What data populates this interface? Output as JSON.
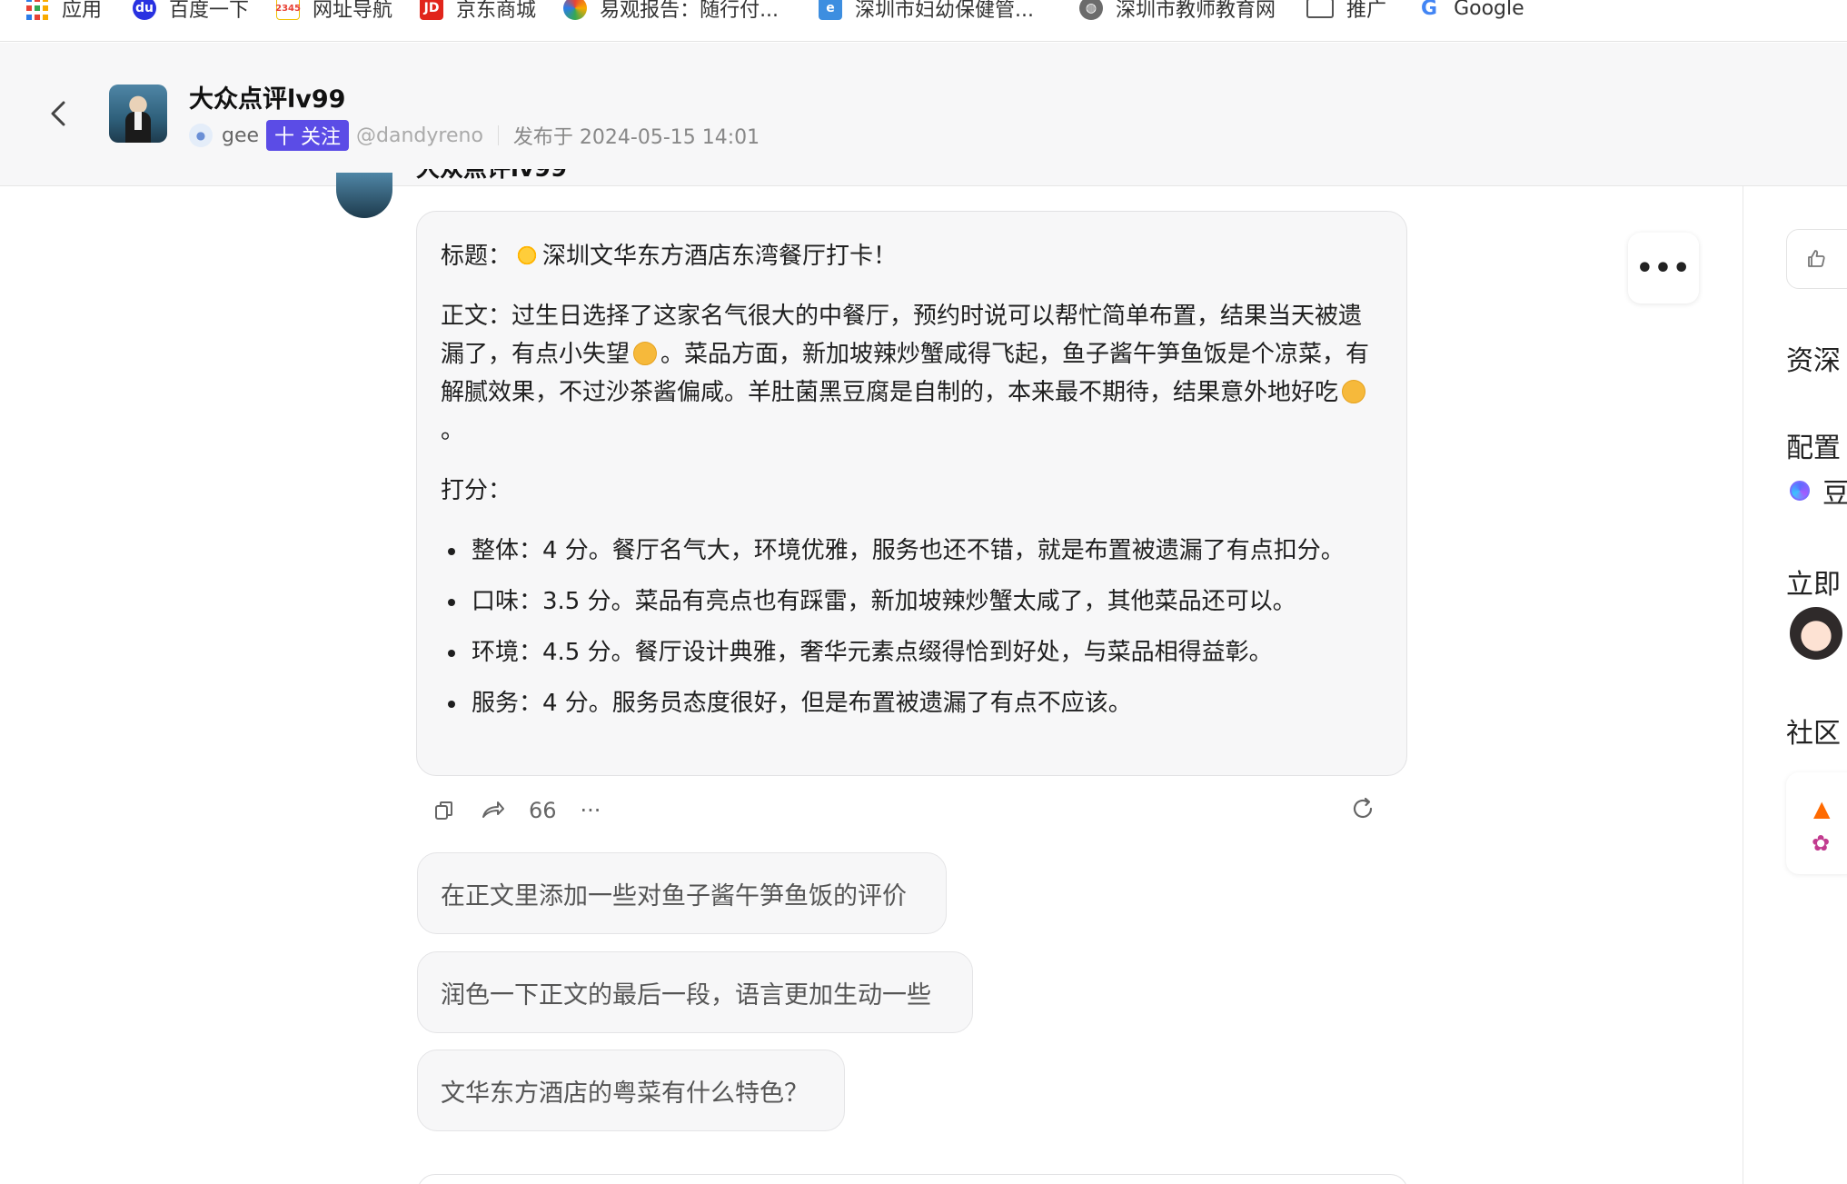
{
  "bookmarks": [
    {
      "label": "应用",
      "icon": "apps-grid-icon"
    },
    {
      "label": "百度一下",
      "icon": "baidu-paw-icon"
    },
    {
      "label": "网址导航",
      "icon": "hao2345-icon"
    },
    {
      "label": "京东商城",
      "icon": "jd-logo-icon"
    },
    {
      "label": "易观报告：随行付...",
      "icon": "analysys-icon"
    },
    {
      "label": "深圳市妇幼保健管...",
      "icon": "hospital-site-icon"
    },
    {
      "label": "深圳市教师教育网",
      "icon": "globe-icon"
    },
    {
      "label": "推广",
      "icon": "folder-icon"
    },
    {
      "label": "Google",
      "icon": "google-g-icon"
    }
  ],
  "header": {
    "title": "大众点评lv99",
    "user_name": "gee",
    "follow_label": "十 关注",
    "handle": "@dandyreno",
    "published": "发布于 2024-05-15 14:01"
  },
  "message": {
    "sender_name": "大众点评lv99",
    "title_prefix": "标题：",
    "title_text": "深圳文华东方酒店东湾餐厅打卡！",
    "body_part1": "正文：过生日选择了这家名气很大的中餐厅，预约时说可以帮忙简单布置，结果当天被遗漏了，有点小失望",
    "body_part2": "。菜品方面，新加坡辣炒蟹咸得飞起，鱼子酱午笋鱼饭是个凉菜，有解腻效果，不过沙茶酱偏咸。羊肚菌黑豆腐是自制的，本来最不期待，结果意外地好吃",
    "body_part3": "。",
    "score_heading": "打分：",
    "scores": [
      "整体：4 分。餐厅名气大，环境优雅，服务也还不错，就是布置被遗漏了有点扣分。",
      "口味：3.5 分。菜品有亮点也有踩雷，新加坡辣炒蟹太咸了，其他菜品还可以。",
      "环境：4.5 分。餐厅设计典雅，奢华元素点缀得恰到好处，与菜品相得益彰。",
      "服务：4 分。服务员态度很好，但是布置被遗漏了有点不应该。"
    ],
    "emojis": [
      "sun-emoji-icon",
      "disappointed-face-icon",
      "yum-face-icon"
    ]
  },
  "actions": {
    "count": "66",
    "more": "···"
  },
  "more_menu_label": "•••",
  "suggestions": [
    "在正文里添加一些对鱼子酱午笋鱼饭的评价",
    "润色一下正文的最后一段，语言更加生动一些",
    "文华东方酒店的粤菜有什么特色？"
  ],
  "right_panel": {
    "line1": "资深",
    "line2": "配置",
    "doubao_label": "豆",
    "line3": "立即",
    "line4": "社区"
  },
  "colors": {
    "follow_bg": "#5b4ce6",
    "card_bg": "#f7f7f8",
    "header_bg": "#f7f7f8"
  }
}
